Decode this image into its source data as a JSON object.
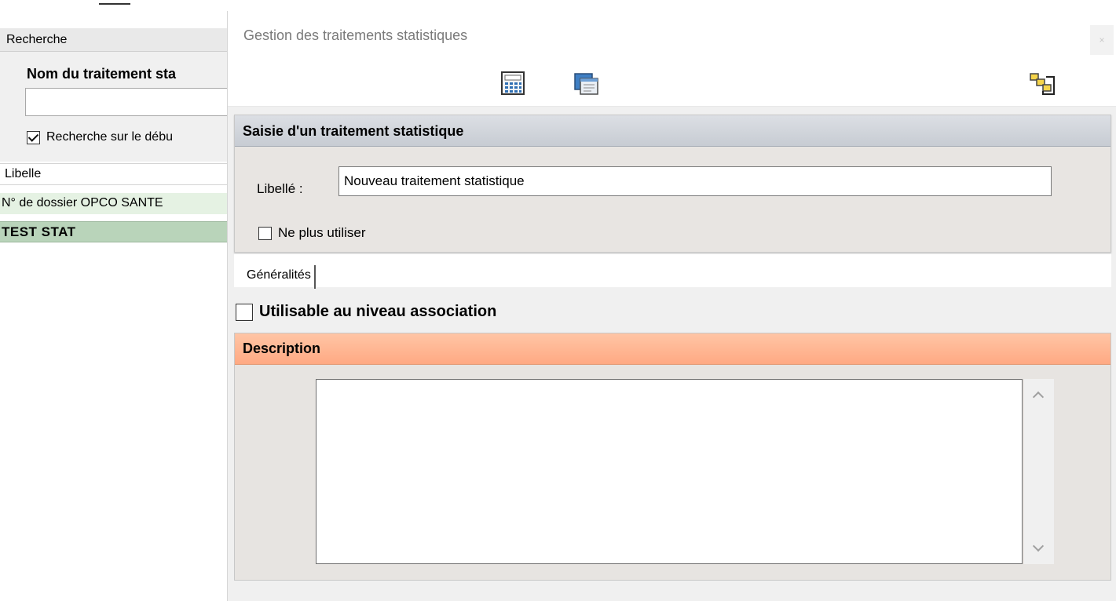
{
  "background_panel": {
    "header": "Recherche",
    "field_label": "Nom du traitement sta",
    "search_value": "",
    "prefix_checkbox_label": "Recherche sur le débu",
    "prefix_checkbox_checked": true,
    "grid_column": "Libelle",
    "rows": [
      "N° de dossier OPCO SANTE",
      "TEST STAT"
    ]
  },
  "dialog": {
    "title": "Gestion des traitements statistiques",
    "close_glyph": "×",
    "toolbar_icons": [
      "calculator-icon",
      "window-icon",
      "structure-icon"
    ],
    "section_title": "Saisie d'un traitement statistique",
    "libelle_label": "Libellé :",
    "libelle_value": "Nouveau traitement statistique",
    "ne_plus_utiliser_label": "Ne plus utiliser",
    "ne_plus_utiliser_checked": false,
    "tabs": [
      "Généralités"
    ],
    "association_label": "Utilisable au niveau association",
    "association_checked": false,
    "description_title": "Description",
    "description_value": ""
  },
  "colors": {
    "section_header": "#c7ccd3",
    "description_header": "#ffa983",
    "selected_row": "#b9d4ba",
    "alt_row": "#e5f2e3"
  }
}
